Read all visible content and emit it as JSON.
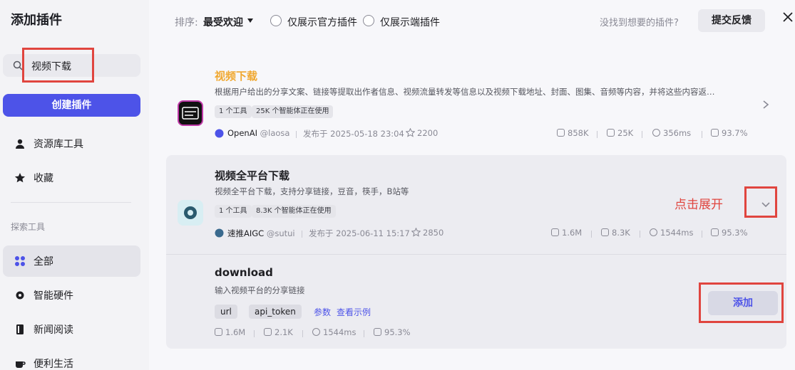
{
  "sidebar": {
    "title": "添加插件",
    "search_value": "视频下载",
    "create_label": "创建插件",
    "nav_top": [
      {
        "label": "资源库工具",
        "icon": "user-icon"
      },
      {
        "label": "收藏",
        "icon": "star-icon"
      }
    ],
    "section_label": "探索工具",
    "nav_explore": [
      {
        "label": "全部",
        "icon": "grid-icon",
        "active": true
      },
      {
        "label": "智能硬件",
        "icon": "gear-icon"
      },
      {
        "label": "新闻阅读",
        "icon": "book-icon"
      },
      {
        "label": "便利生活",
        "icon": "cup-icon"
      }
    ]
  },
  "toolbar": {
    "sort_label": "排序:",
    "sort_value": "最受欢迎",
    "filter_official": "仅展示官方插件",
    "filter_client": "仅展示端插件",
    "not_found": "没找到想要的插件?",
    "feedback": "提交反馈"
  },
  "plugins": [
    {
      "title": "视频下载",
      "desc": "根据用户给出的分享文案、链接等提取出作者信息、视频流量转发等信息以及视频下载地址、封面、图集、音频等内容，并将这些内容返…",
      "tags": [
        "1 个工具",
        "25K 个智能体正在使用"
      ],
      "author": "OpenAI",
      "handle": "@laosa",
      "published": "发布于 2025-05-18 23:04",
      "stars": "2200",
      "stats": [
        "858K",
        "25K",
        "356ms",
        "93.7%"
      ]
    },
    {
      "title": "视频全平台下载",
      "desc": "视频全平台下载，支持分享链接，豆音，筷手，B站等",
      "tags": [
        "1 个工具",
        "8.3K 个智能体正在使用"
      ],
      "author": "速推AIGC",
      "handle": "@sutui",
      "published": "发布于 2025-06-11 15:17",
      "stars": "2850",
      "stats": [
        "1.6M",
        "8.3K",
        "1544ms",
        "95.3%"
      ]
    }
  ],
  "annotation_expand": "点击展开",
  "tool": {
    "name": "download",
    "desc": "输入视频平台的分享链接",
    "params": [
      "url",
      "api_token"
    ],
    "params_link": "参数",
    "example_link": "查看示例",
    "stats": [
      "1.6M",
      "2.1K",
      "1544ms",
      "95.3%"
    ],
    "add_label": "添加"
  },
  "colors": {
    "accent": "#4d53e8",
    "highlight": "#e0453f",
    "title_orange": "#f0a830"
  }
}
